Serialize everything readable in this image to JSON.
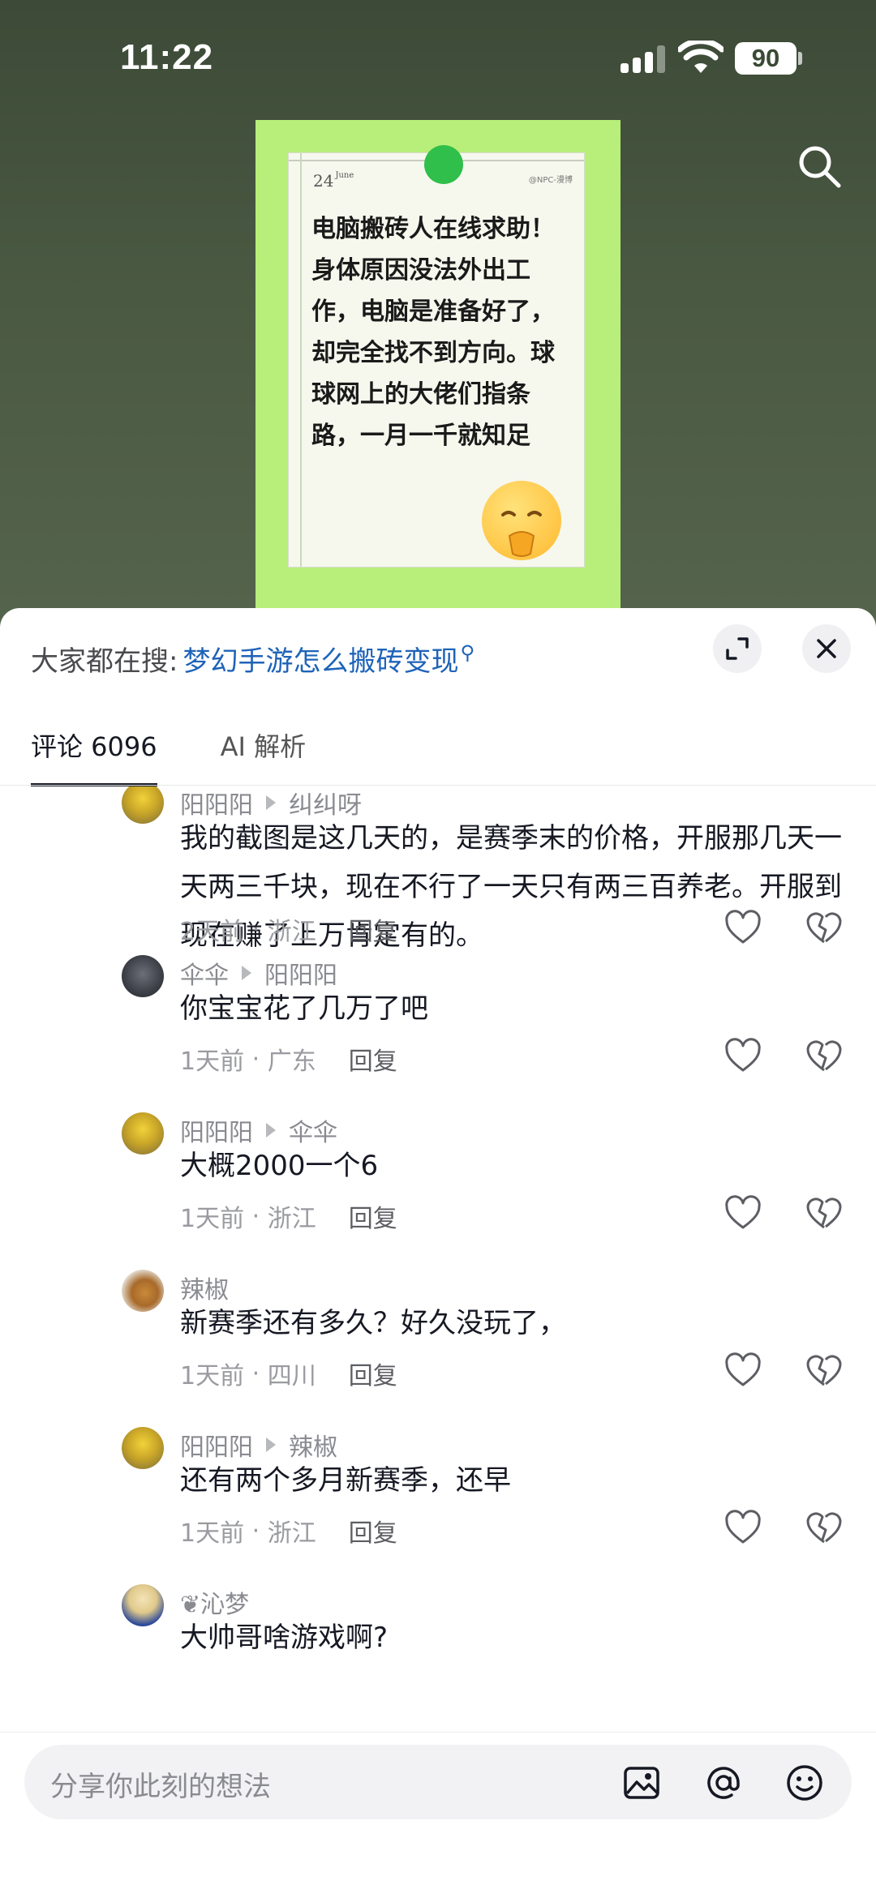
{
  "status_bar": {
    "time": "11:22",
    "battery": "90"
  },
  "post": {
    "date": "24",
    "date_month": "June",
    "handle": "@NPC-漫博",
    "text": "电脑搬砖人在线求助！身体原因没法外出工作，电脑是准备好了，却完全找不到方向。球球网上的大佬们指条路，一月一千就知足"
  },
  "trending": {
    "label": "大家都在搜:",
    "query": "梦幻手游怎么搬砖变现"
  },
  "tabs": [
    {
      "label": "评论 6096",
      "active": true
    },
    {
      "label": "AI 解析",
      "active": false
    }
  ],
  "replies": [
    {
      "author": "阳阳阳",
      "reply_to": "纠纠呀",
      "text": "我的截图是这几天的，是赛季末的价格，开服那几天一天两三千块，现在不行了一天只有两三百养老。开服到现在赚了上万肯定有的。",
      "time": "2天前",
      "location": "浙江",
      "reply_label": "回复"
    },
    {
      "author": "伞伞",
      "reply_to": "阳阳阳",
      "text": "你宝宝花了几万了吧",
      "time": "1天前",
      "location": "广东",
      "reply_label": "回复"
    },
    {
      "author": "阳阳阳",
      "reply_to": "伞伞",
      "text": "大概2000一个6",
      "time": "1天前",
      "location": "浙江",
      "reply_label": "回复"
    },
    {
      "author": "辣椒",
      "reply_to": "",
      "text": "新赛季还有多久？好久没玩了，",
      "time": "1天前",
      "location": "四川",
      "reply_label": "回复"
    },
    {
      "author": "阳阳阳",
      "reply_to": "辣椒",
      "text": "还有两个多月新赛季，还早",
      "time": "1天前",
      "location": "浙江",
      "reply_label": "回复"
    },
    {
      "author": "❦沁梦",
      "reply_to": "",
      "text": "大帅哥啥游戏啊?",
      "time": "",
      "location": "",
      "reply_label": ""
    }
  ],
  "input": {
    "placeholder": "分享你此刻的想法"
  },
  "colors": {
    "accent_link": "#1e63b8",
    "post_bg": "#b8ee7a",
    "pin": "#2fbf4a"
  }
}
